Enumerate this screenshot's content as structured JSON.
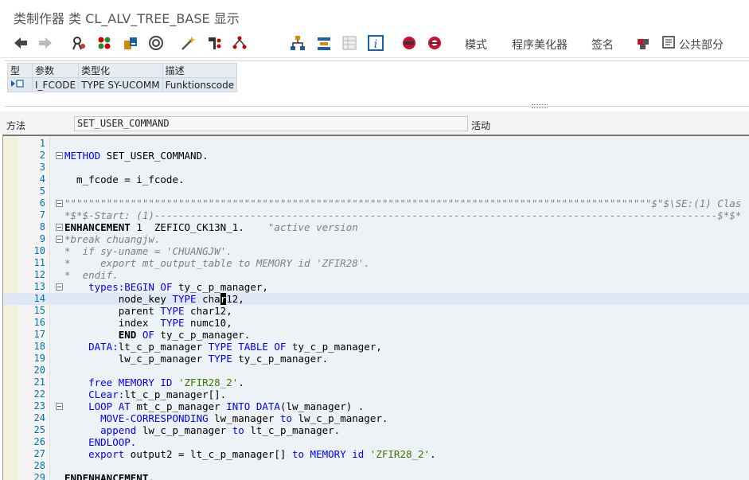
{
  "window": {
    "title": "类制作器 类 CL_ALV_TREE_BASE 显示"
  },
  "toolbar": {
    "buttons": [
      {
        "name": "back-icon"
      },
      {
        "name": "forward-icon"
      },
      {
        "name": "other-object-icon"
      },
      {
        "name": "display-change-icon"
      },
      {
        "name": "active-inactive-icon"
      },
      {
        "name": "check-icon"
      },
      {
        "name": "activate-icon"
      },
      {
        "name": "where-used-icon"
      },
      {
        "name": "object-list-icon"
      },
      {
        "name": "hierarchy-icon"
      },
      {
        "name": "navigation-window-icon"
      },
      {
        "name": "table-view-icon"
      },
      {
        "name": "info-icon"
      },
      {
        "name": "breakpoint-icon"
      },
      {
        "name": "session-breakpoint-icon"
      }
    ],
    "mode_label": "模式",
    "pretty_printer_label": "程序美化器",
    "signature_label": "签名",
    "public_section_label": "公共部分"
  },
  "params": {
    "headers": [
      "型",
      "参数",
      "类型化",
      "描述"
    ],
    "rows": [
      {
        "type_icon": "import-parameter-icon",
        "param": "I_FCODE",
        "typing": "TYPE SY-UCOMM",
        "desc": "Funktionscode"
      }
    ]
  },
  "method": {
    "label": "方法",
    "value": "SET_USER_COMMAND",
    "status": "活动"
  },
  "editor": {
    "line_numbers": [
      "1",
      "2",
      "3",
      "4",
      "5",
      "6",
      "7",
      "8",
      "9",
      "10",
      "11",
      "12",
      "13",
      "14",
      "15",
      "16",
      "17",
      "18",
      "19",
      "20",
      "21",
      "22",
      "23",
      "24",
      "25",
      "26",
      "27",
      "28",
      "29"
    ],
    "text": {
      "l2a": "METHOD",
      "l2b": " SET_USER_COMMAND.",
      "l4": "  m_fcode = i_fcode.",
      "l6": "\"\"\"\"\"\"\"\"\"\"\"\"\"\"\"\"\"\"\"\"\"\"\"\"\"\"\"\"\"\"\"\"\"\"\"\"\"\"\"\"\"\"\"\"\"\"\"\"\"\"\"\"\"\"\"\"\"\"\"\"\"\"\"\"\"\"\"\"\"\"\"\"\"\"\"\"\"\"\"\"\"\"\"\"\"\"\"\"\"\"\"\"\"\"\"\"\"\"$\"$\\SE:(1) Clas",
      "l7": "*$*$-Start: (1)----------------------------------------------------------------------------------------------$*$*",
      "l8a": "ENHANCEMENT",
      "l8b": " 1  ZEFICO_CK13N_1.",
      "l8c": "    \"active version",
      "l9": "*break chuangjw.",
      "l10": "*  if sy-uname = 'CHUANGJW'.",
      "l11": "*     export mt_output_table to MEMORY id 'ZFIR28'.",
      "l12": "*  endif.",
      "l13a": "    types:",
      "l13b": "BEGIN OF",
      "l13c": " ty_c_p_manager,",
      "l14a": "         node_key ",
      "l14b": "TYPE",
      "l14c": " cha",
      "l14d": "r",
      "l14e": "12,",
      "l15a": "         parent ",
      "l15b": "TYPE",
      "l15c": " char12,",
      "l16a": "         index  ",
      "l16b": "TYPE",
      "l16c": " numc10,",
      "l17a": "         ",
      "l17b": "END",
      "l17c": " ",
      "l17d": "OF",
      "l17e": " ty_c_p_manager.",
      "l18a": "    DATA:",
      "l18b": "lt_c_p_manager ",
      "l18c": "TYPE TABLE OF",
      "l18d": " ty_c_p_manager,",
      "l19a": "         lw_c_p_manager ",
      "l19b": "TYPE",
      "l19c": " ty_c_p_manager.",
      "l21a": "    free MEMORY ID ",
      "l21b": "'ZFIR28_2'",
      "l21c": ".",
      "l22a": "    CLear:",
      "l22b": "lt_c_p_manager[].",
      "l23a": "    LOOP AT",
      "l23b": " mt_c_p_manager ",
      "l23c": "INTO DATA",
      "l23d": "(lw_manager) .",
      "l24a": "      MOVE-CORRESPONDING",
      "l24b": " lw_manager ",
      "l24c": "to",
      "l24d": " lw_c_p_manager.",
      "l25a": "      append",
      "l25b": " lw_c_p_manager ",
      "l25c": "to",
      "l25d": " lt_c_p_manager.",
      "l26": "    ENDLOOP.",
      "l27a": "    export",
      "l27b": " output2 = lt_c_p_manager[] ",
      "l27c": "to MEMORY id ",
      "l27d": "'ZFIR28_2'",
      "l27e": ".",
      "l29": "ENDENHANCEMENT."
    }
  }
}
